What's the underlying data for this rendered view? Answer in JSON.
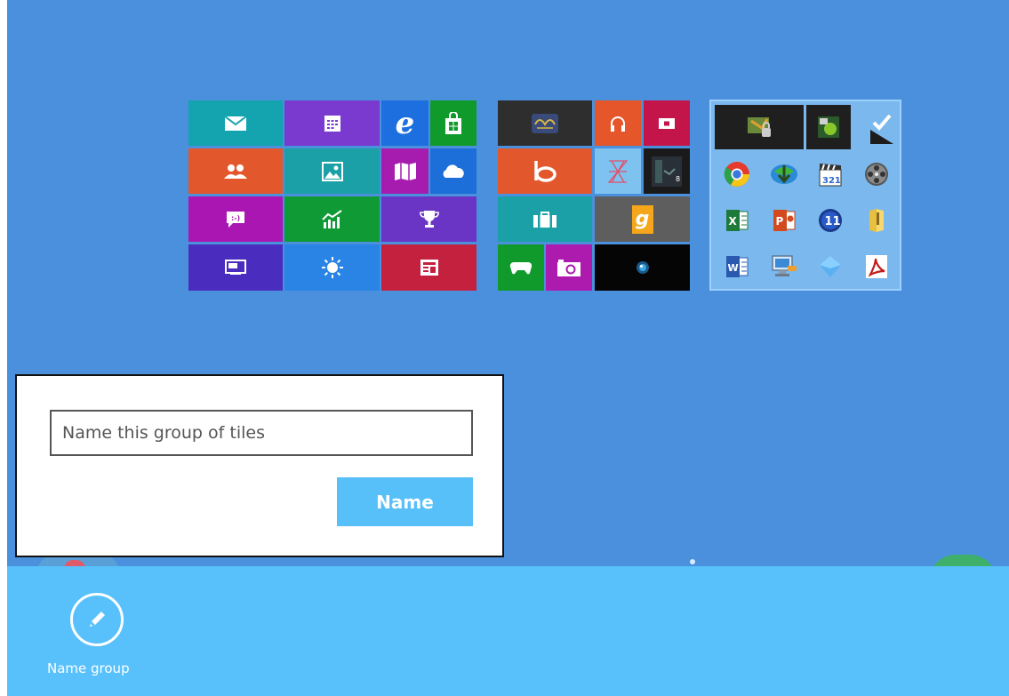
{
  "start_screen": {
    "groups": [
      {
        "name": "group-1",
        "tiles": [
          "Mail",
          "Calendar",
          "Internet Explorer",
          "Store",
          "People",
          "Photos",
          "Maps",
          "SkyDrive",
          "Messaging",
          "Finance",
          "Sports",
          "Desktop",
          "Weather",
          "News"
        ]
      },
      {
        "name": "group-2",
        "tiles": [
          "Quran",
          "Music",
          "Video",
          "Bing",
          "Zune",
          "Win8 app",
          "Travel",
          "Goodreads",
          "Xbox Games",
          "Camera",
          "Media app"
        ]
      },
      {
        "name": "group-3",
        "tiles": [
          "Security app",
          "Game app",
          "Checked tile",
          "Google Chrome",
          "Internet Download Manager",
          "Media Player Classic",
          "Media app",
          "Microsoft Excel",
          "Microsoft PowerPoint",
          "Winamp",
          "Folder",
          "Microsoft Word",
          "Remote Desktop",
          "Network app",
          "Adobe Reader"
        ]
      }
    ]
  },
  "dialog": {
    "input_placeholder": "Name this group of tiles",
    "input_value": "",
    "button_label": "Name"
  },
  "appbar": {
    "command_label": "Name group",
    "command_icon": "pencil-icon"
  },
  "colors": {
    "background": "#4a90dc",
    "appbar": "#58c1fb",
    "accent_button": "#58c0f8"
  }
}
